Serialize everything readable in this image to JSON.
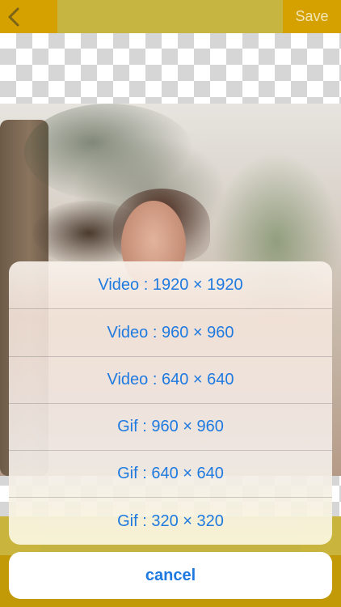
{
  "toolbar": {
    "back_icon": "chevron-left-icon",
    "save_label": "Save",
    "colors": {
      "side": "#d4a100",
      "middle": "#c7b541",
      "save_text": "#f2e6b6"
    }
  },
  "sheet": {
    "options": [
      {
        "label": "Video : 1920 × 1920"
      },
      {
        "label": "Video : 960 × 960"
      },
      {
        "label": "Video : 640 × 640"
      },
      {
        "label": "Gif : 960 × 960"
      },
      {
        "label": "Gif : 640 × 640"
      },
      {
        "label": "Gif : 320 × 320"
      }
    ],
    "cancel_label": "cancel",
    "accent_color": "#1f7ae0"
  }
}
